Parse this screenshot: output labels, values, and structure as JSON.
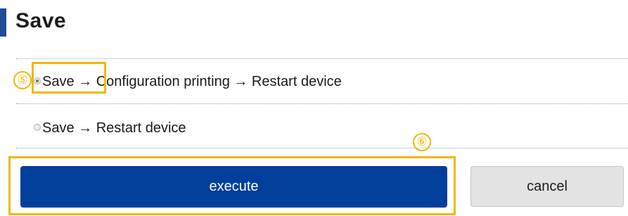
{
  "header": {
    "title": "Save"
  },
  "options": [
    {
      "label": "Save → Configuration printing → Restart device",
      "checked": true
    },
    {
      "label": "Save → Restart device",
      "checked": false
    }
  ],
  "actions": {
    "execute_label": "execute",
    "cancel_label": "cancel"
  },
  "annotations": {
    "callout_5": "⑤",
    "callout_6": "⑥"
  },
  "colors": {
    "accent_bar": "#1f4b99",
    "execute_bg": "#003f9a",
    "cancel_bg": "#e3e3e3",
    "callout": "#f2b705"
  }
}
